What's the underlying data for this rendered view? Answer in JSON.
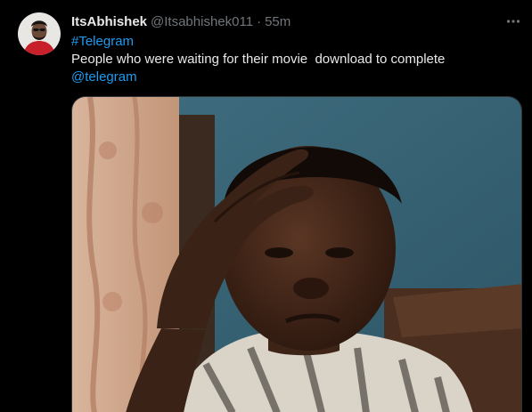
{
  "tweet": {
    "display_name": "ItsAbhishek",
    "handle": "@Itsabhishek011",
    "separator": "·",
    "time": "55m",
    "hashtag": "#Telegram",
    "body": "People who were waiting for their movie  download to complete",
    "mention": "@telegram",
    "more_icon": "more-horizontal-icon"
  },
  "colors": {
    "background": "#000000",
    "text": "#e7e9ea",
    "secondary": "#71767b",
    "link": "#1d9bf0"
  }
}
